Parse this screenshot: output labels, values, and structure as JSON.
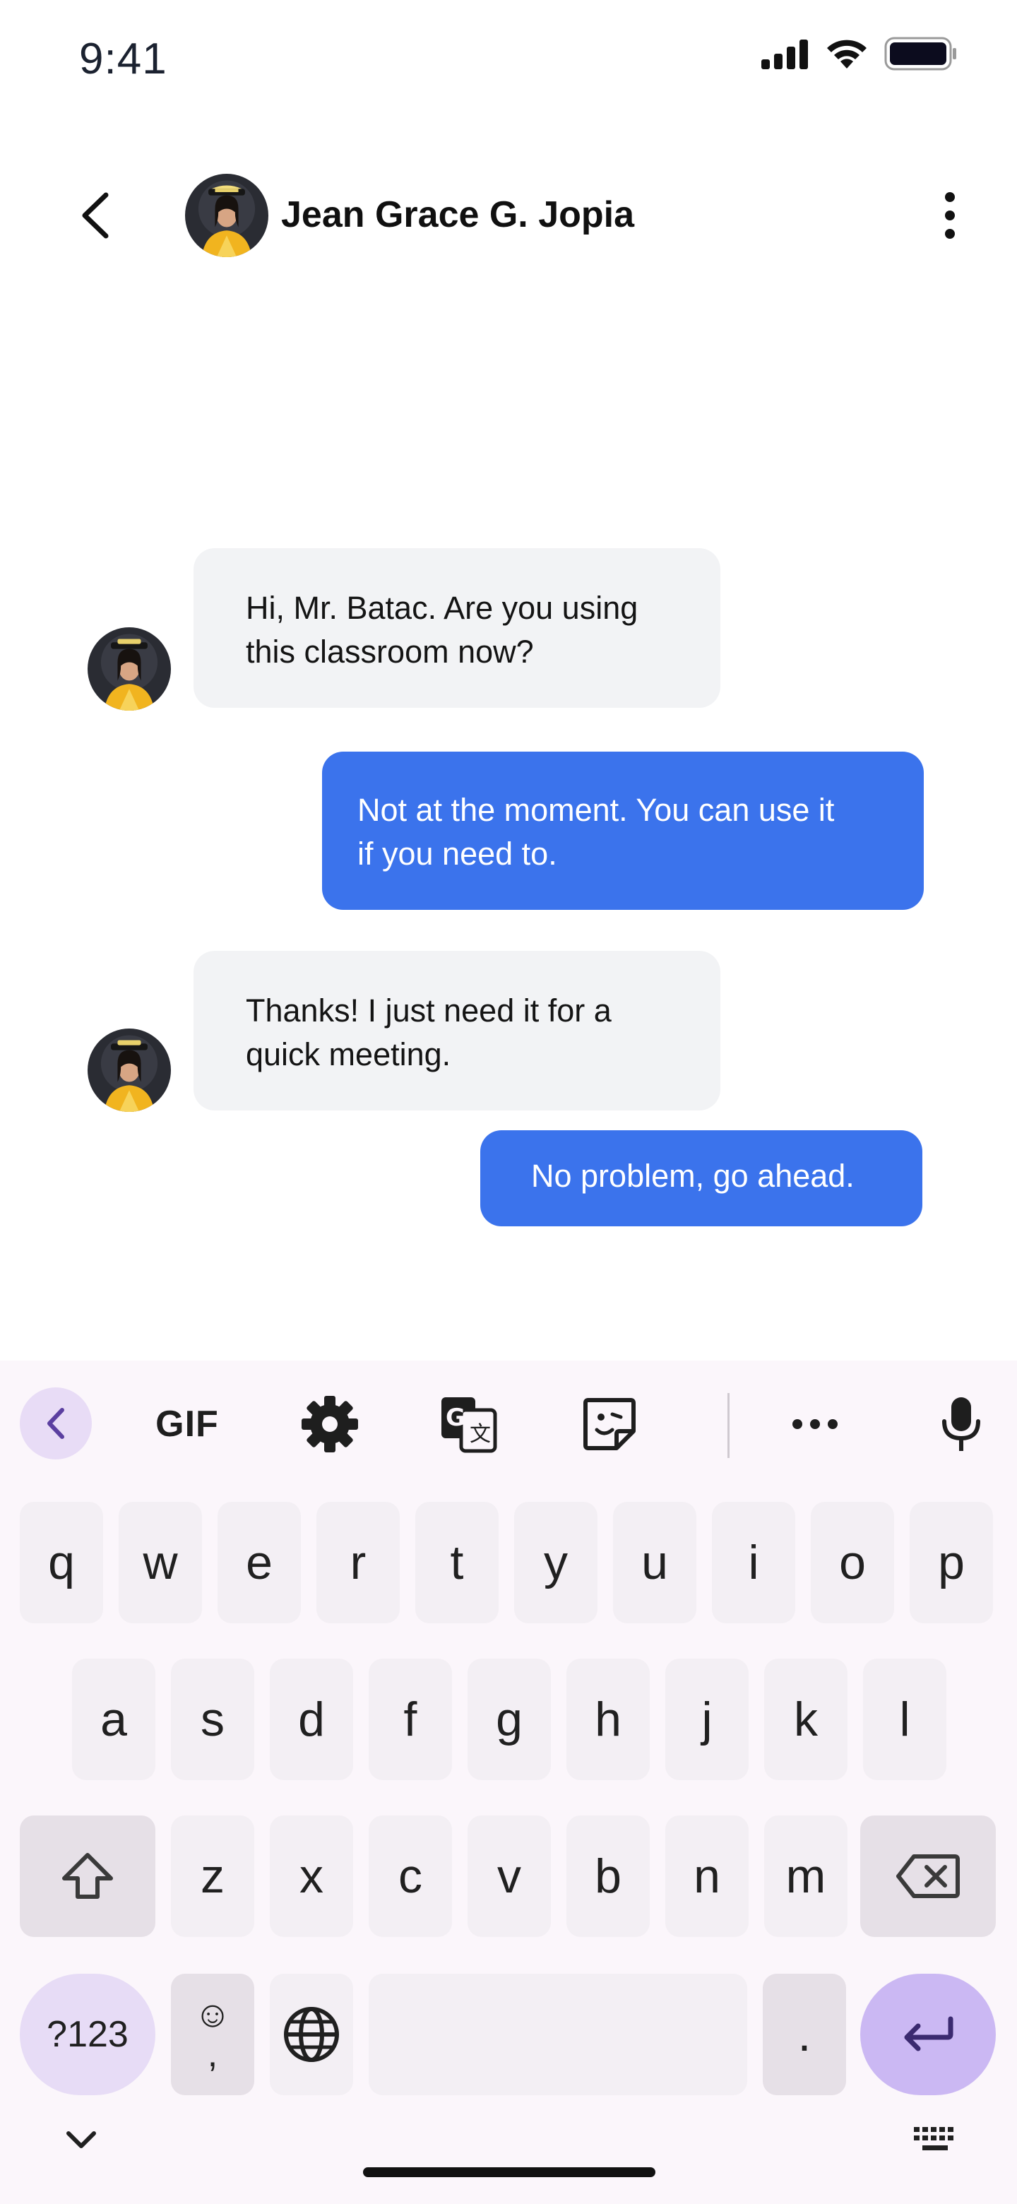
{
  "status_bar": {
    "time": "9:41",
    "icons": [
      "signal-icon",
      "wifi-icon",
      "battery-icon"
    ]
  },
  "header": {
    "contact_name": "Jean Grace G. Jopia",
    "back_icon": "chevron-left-icon",
    "more_icon": "more-vertical-icon"
  },
  "messages": [
    {
      "direction": "incoming",
      "lines": [
        "Hi, Mr. Batac. Are you using",
        "this classroom now?"
      ]
    },
    {
      "direction": "outgoing",
      "lines": [
        "Not at the moment. You can use it",
        "if you need to."
      ]
    },
    {
      "direction": "incoming",
      "lines": [
        "Thanks! I just need it for a",
        "quick meeting."
      ]
    },
    {
      "direction": "outgoing",
      "lines": [
        "No problem, go ahead."
      ]
    }
  ],
  "keyboard": {
    "toolbar": {
      "gif_label": "GIF",
      "icons": [
        "chevron-left-icon",
        "gif-button",
        "settings-icon",
        "translate-icon",
        "sticker-icon",
        "more-horizontal-icon",
        "microphone-icon"
      ]
    },
    "row1": [
      "q",
      "w",
      "e",
      "r",
      "t",
      "y",
      "u",
      "i",
      "o",
      "p"
    ],
    "row2": [
      "a",
      "s",
      "d",
      "f",
      "g",
      "h",
      "j",
      "k",
      "l"
    ],
    "row3": [
      "z",
      "x",
      "c",
      "v",
      "b",
      "n",
      "m"
    ],
    "mode_key": "?123",
    "emoji_key": {
      "top": "☺",
      "bottom": ","
    },
    "period_key": ".",
    "colors": {
      "accent": "#cbb8f3",
      "bubble_out": "#3b73ec",
      "bubble_in": "#f2f3f5"
    }
  }
}
